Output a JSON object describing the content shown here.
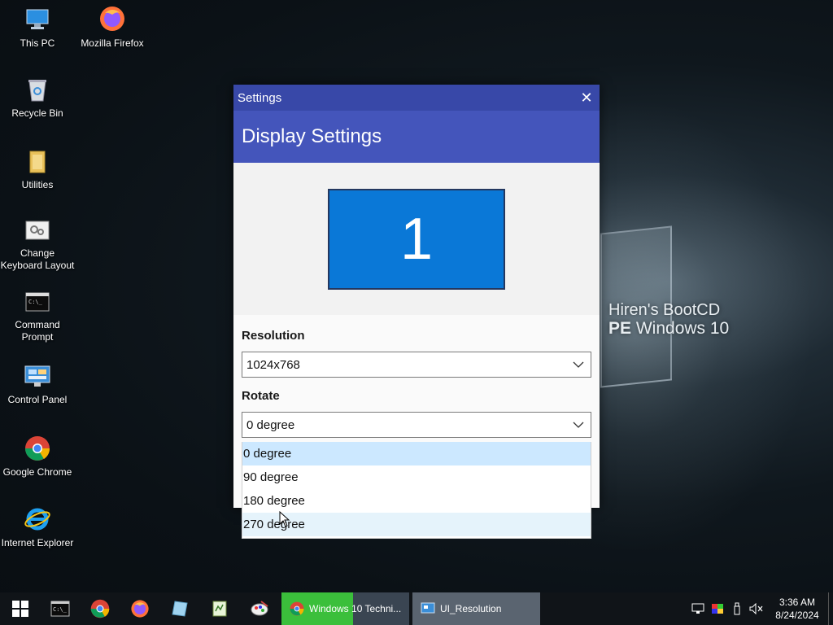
{
  "desktop": {
    "icons": [
      {
        "label": "This PC"
      },
      {
        "label": "Mozilla Firefox"
      },
      {
        "label": "Recycle Bin"
      },
      {
        "label": "Utilities"
      },
      {
        "label": "Change Keyboard Layout"
      },
      {
        "label": "Command Prompt"
      },
      {
        "label": "Control Panel"
      },
      {
        "label": "Google Chrome"
      },
      {
        "label": "Internet Explorer"
      }
    ],
    "wallpaper": {
      "line1": "Hiren's BootCD",
      "line2_bold": "PE",
      "line2_rest": " Windows 10"
    }
  },
  "window": {
    "title": "Settings",
    "close_glyph": "✕",
    "header": "Display Settings",
    "monitor_number": "1",
    "resolution": {
      "label": "Resolution",
      "value": "1024x768"
    },
    "rotate": {
      "label": "Rotate",
      "value": "0 degree"
    }
  },
  "dropdown": {
    "options": [
      "0 degree",
      "90 degree",
      "180 degree",
      "270 degree"
    ],
    "selected": "0 degree",
    "hovered": "270 degree"
  },
  "taskbar": {
    "tasks": [
      {
        "label": "Windows 10 Techni...",
        "app": "chrome-icon"
      },
      {
        "label": "UI_Resolution",
        "app": "app-icon"
      }
    ],
    "clock": {
      "time": "3:36 AM",
      "date": "8/24/2024"
    }
  },
  "colors": {
    "titlebar": "#3848a8",
    "header": "#4455bb",
    "monitor": "#0a78d7",
    "selected_option": "#cce8ff"
  }
}
